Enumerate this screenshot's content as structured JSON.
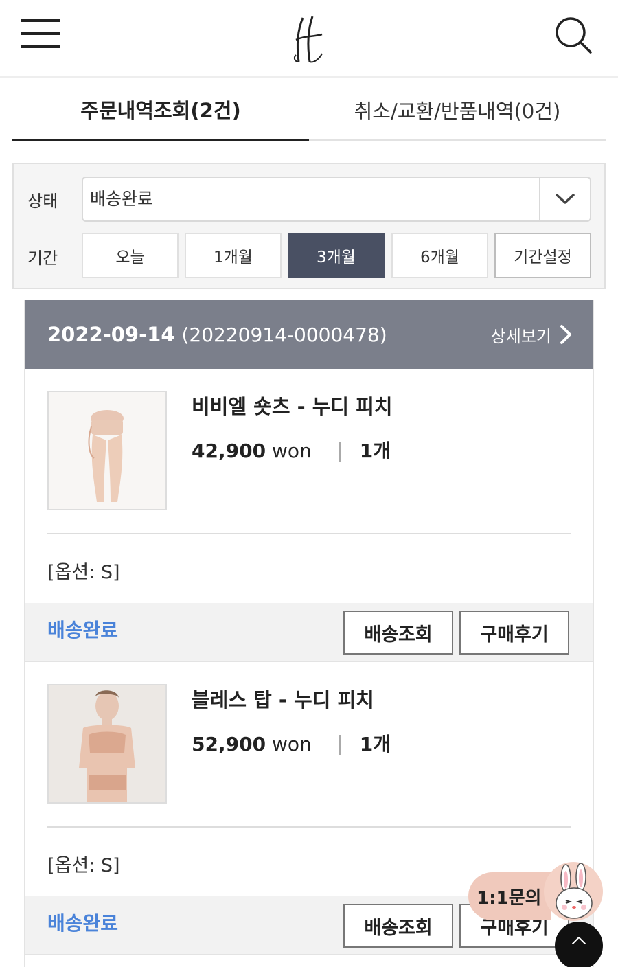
{
  "header": {
    "menu_icon": "hamburger-menu-icon",
    "logo_icon": "brand-logo",
    "search_icon": "search-icon"
  },
  "tabs": [
    {
      "label": "주문내역조회(2건)",
      "active": true
    },
    {
      "label": "취소/교환/반품내역(0건)",
      "active": false
    }
  ],
  "filter": {
    "status_label": "상태",
    "status_value": "배송완료",
    "period_label": "기간",
    "periods": [
      "오늘",
      "1개월",
      "3개월",
      "6개월",
      "기간설정"
    ],
    "selected_period": "3개월"
  },
  "order": {
    "date": "2022-09-14",
    "number": "(20220914-0000478)",
    "detail_label": "상세보기",
    "items": [
      {
        "name": "비비엘 숏츠 - 누디 피치",
        "price": "42,900",
        "currency": "won",
        "qty": "1",
        "qty_unit": "개",
        "option": "[옵션: S]",
        "status": "배송완료",
        "track_label": "배송조회",
        "review_label": "구매후기"
      },
      {
        "name": "블레스 탑 - 누디 피치",
        "price": "52,900",
        "currency": "won",
        "qty": "1",
        "qty_unit": "개",
        "option": "[옵션: S]",
        "status": "배송완료",
        "track_label": "배송조회",
        "review_label": "구매후기"
      }
    ]
  },
  "floating": {
    "inquiry_label": "1:1문의",
    "top_icon": "chevron-up-icon"
  },
  "colors": {
    "accent_status": "#4a83d9",
    "selected_period_bg": "#495063",
    "order_header_bg": "#7b7f8b"
  }
}
